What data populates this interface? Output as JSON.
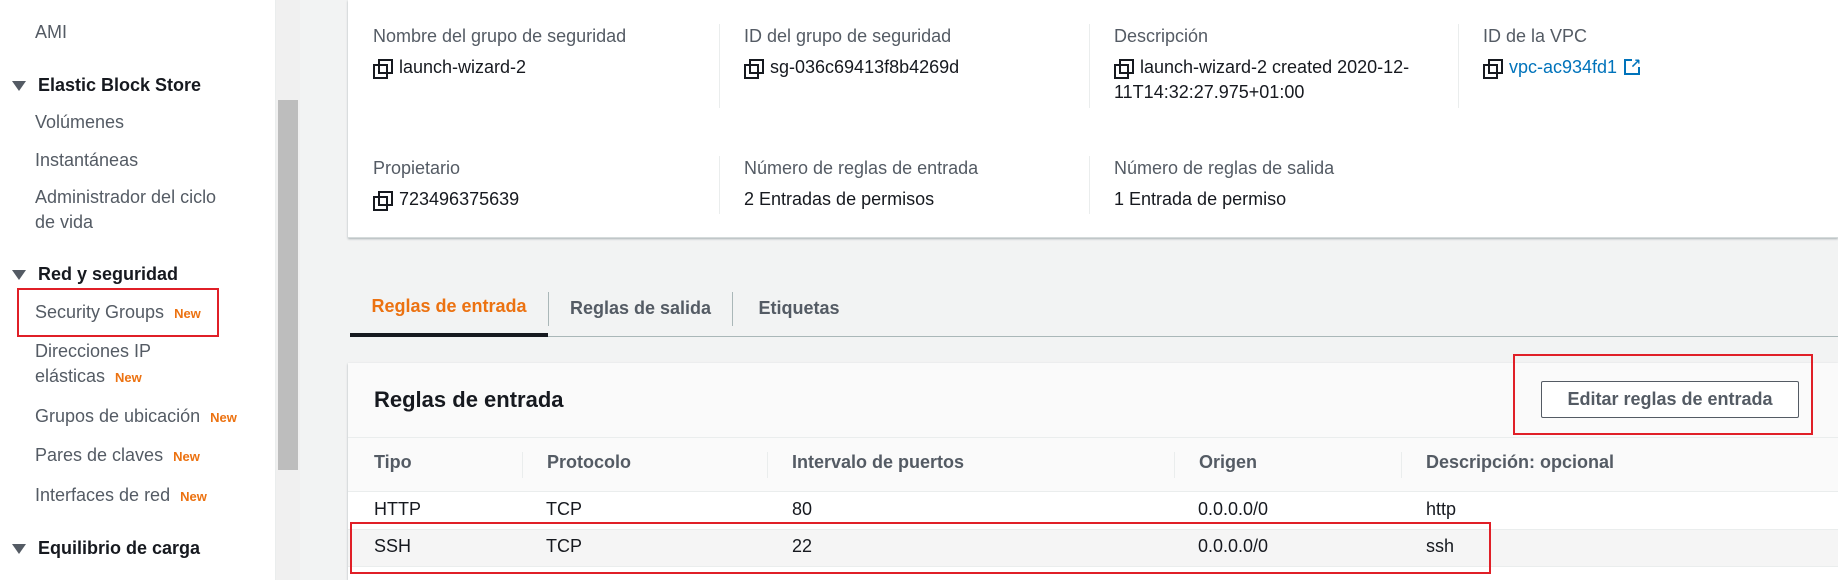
{
  "sidebar": {
    "top_item": "AMI",
    "sections": [
      {
        "title": "Elastic Block Store",
        "items": [
          "Volúmenes",
          "Instantáneas",
          "Administrador del ciclo",
          "de vida"
        ]
      },
      {
        "title": "Red y seguridad",
        "items": [
          "Security Groups",
          "Direcciones IP",
          "elásticas",
          "Grupos de ubicación",
          "Pares de claves",
          "Interfaces de red"
        ]
      },
      {
        "title": "Equilibrio de carga"
      }
    ],
    "new_badge": "New"
  },
  "details": {
    "group_name_label": "Nombre del grupo de seguridad",
    "group_name": "launch-wizard-2",
    "group_id_label": "ID del grupo de seguridad",
    "group_id": "sg-036c69413f8b4269d",
    "description_label": "Descripción",
    "description_line1": "launch-wizard-2 created 2020-12-",
    "description_line2": "11T14:32:27.975+01:00",
    "vpc_label": "ID de la VPC",
    "vpc_id": "vpc-ac934fd1",
    "owner_label": "Propietario",
    "owner": "723496375639",
    "inbound_count_label": "Número de reglas de entrada",
    "inbound_count": "2 Entradas de permisos",
    "outbound_count_label": "Número de reglas de salida",
    "outbound_count": "1 Entrada de permiso"
  },
  "tabs": [
    "Reglas de entrada",
    "Reglas de salida",
    "Etiquetas"
  ],
  "rules": {
    "title": "Reglas de entrada",
    "edit_button": "Editar reglas de entrada",
    "columns": [
      "Tipo",
      "Protocolo",
      "Intervalo de puertos",
      "Origen",
      "Descripción: opcional"
    ],
    "rows": [
      [
        "HTTP",
        "TCP",
        "80",
        "0.0.0.0/0",
        "http"
      ],
      [
        "SSH",
        "TCP",
        "22",
        "0.0.0.0/0",
        "ssh"
      ]
    ]
  },
  "colors": {
    "accent": "#ec7211",
    "link": "#0073bb",
    "highlight": "#e01f27"
  }
}
